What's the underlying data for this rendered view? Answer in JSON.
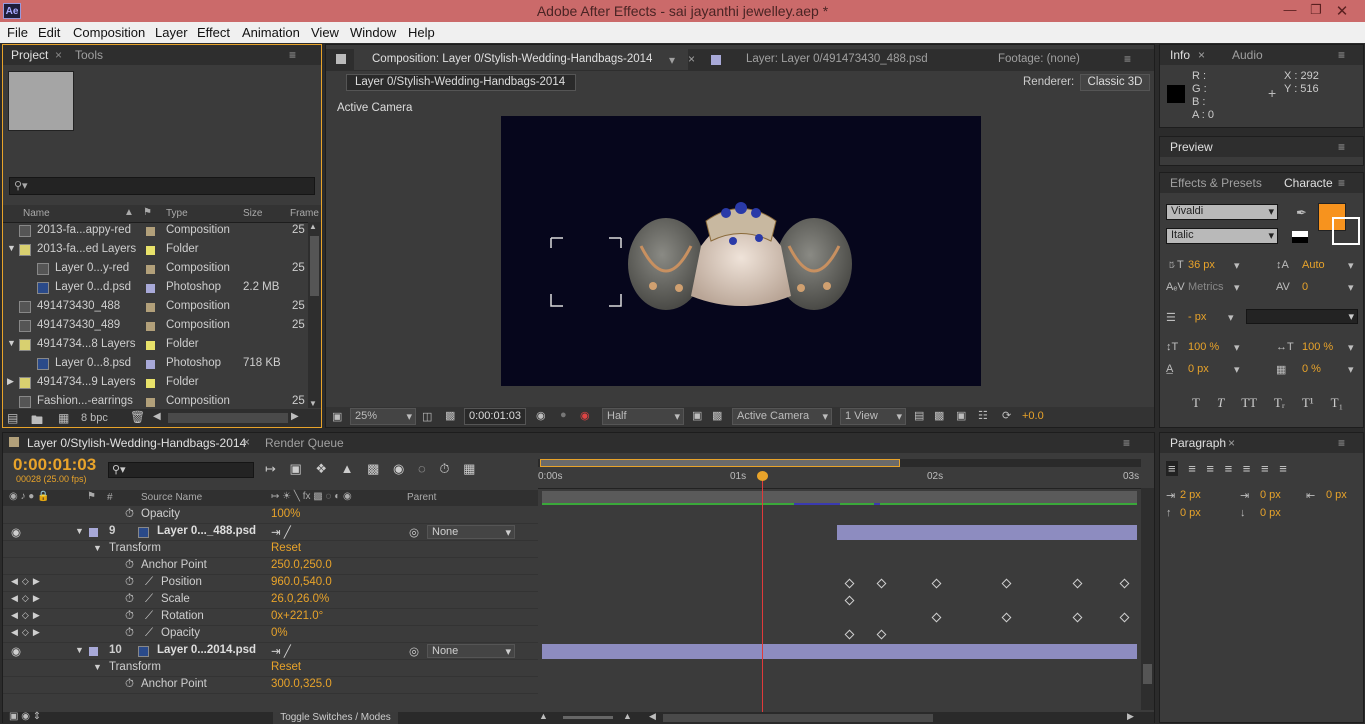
{
  "app": {
    "title": "Adobe After Effects - sai jayanthi jewelley.aep *",
    "logo": "Ae"
  },
  "menu": [
    "File",
    "Edit",
    "Composition",
    "Layer",
    "Effect",
    "Animation",
    "View",
    "Window",
    "Help"
  ],
  "project": {
    "tabs": [
      "Project",
      "Tools"
    ],
    "columns": [
      "Name",
      "Type",
      "Size",
      "Frame"
    ],
    "items": [
      {
        "name": "2013-fa...appy-red",
        "type": "Composition",
        "size": "",
        "frame": "25",
        "color": "#b2a07a",
        "icon": "composition-icon"
      },
      {
        "name": "2013-fa...ed Layers",
        "type": "Folder",
        "size": "",
        "frame": "",
        "color": "#e8e26a",
        "icon": "folder-icon"
      },
      {
        "name": "Layer 0...y-red",
        "type": "Composition",
        "size": "",
        "frame": "25",
        "color": "#b2a07a",
        "icon": "composition-icon"
      },
      {
        "name": "Layer 0...d.psd",
        "type": "Photoshop",
        "size": "2.2 MB",
        "frame": "",
        "color": "#a8a9d8",
        "icon": "photoshop-icon"
      },
      {
        "name": "491473430_488",
        "type": "Composition",
        "size": "",
        "frame": "25",
        "color": "#b2a07a",
        "icon": "composition-icon"
      },
      {
        "name": "491473430_489",
        "type": "Composition",
        "size": "",
        "frame": "25",
        "color": "#b2a07a",
        "icon": "composition-icon"
      },
      {
        "name": "4914734...8 Layers",
        "type": "Folder",
        "size": "",
        "frame": "",
        "color": "#e8e26a",
        "icon": "folder-icon"
      },
      {
        "name": "Layer 0...8.psd",
        "type": "Photoshop",
        "size": "718 KB",
        "frame": "",
        "color": "#a8a9d8",
        "icon": "photoshop-icon"
      },
      {
        "name": "4914734...9 Layers",
        "type": "Folder",
        "size": "",
        "frame": "",
        "color": "#e8e26a",
        "icon": "folder-icon"
      },
      {
        "name": "Fashion...-earrings",
        "type": "Composition",
        "size": "",
        "frame": "25",
        "color": "#b2a07a",
        "icon": "composition-icon"
      }
    ],
    "bpc": "8 bpc"
  },
  "composition": {
    "tab": "Composition: Layer 0/Stylish-Wedding-Handbags-2014",
    "layer_tab": "Layer: Layer 0/491473430_488.psd",
    "footage_tab": "Footage: (none)",
    "breadcrumb": "Layer 0/Stylish-Wedding-Handbags-2014",
    "renderer_label": "Renderer:",
    "renderer": "Classic 3D",
    "camera_label": "Active Camera",
    "zoom": "25%",
    "time": "0:00:01:03",
    "resolution": "Half",
    "view": "Active Camera",
    "views": "1 View",
    "exposure": "+0.0"
  },
  "info": {
    "tabs": [
      "Info",
      "Audio"
    ],
    "r": "R :",
    "g": "G :",
    "b": "B :",
    "a": "A : 0",
    "x": "X : 292",
    "y": "Y : 516"
  },
  "preview": {
    "tab": "Preview"
  },
  "character": {
    "tabs": [
      "Effects & Presets",
      "Characte"
    ],
    "font": "Vivaldi",
    "style": "Italic",
    "size": "36 px",
    "leading": "Auto",
    "kerning": "Metrics",
    "tracking": "0",
    "stroke": "- px",
    "vscale": "100 %",
    "hscale": "100 %",
    "baseline": "0 px",
    "tsume": "0 %",
    "fill_color": "#f7931e"
  },
  "paragraph": {
    "tab": "Paragraph",
    "indent_left": "2 px",
    "indent_first": "0 px",
    "indent_right": "0 px",
    "space_before": "0 px",
    "space_after": "0 px"
  },
  "timeline": {
    "tabs": [
      "Layer 0/Stylish-Wedding-Handbags-2014",
      "Render Queue"
    ],
    "time": "0:00:01:03",
    "frames": "00028 (25.00 fps)",
    "col_source": "Source Name",
    "col_parent": "Parent",
    "ruler": [
      "0:00s",
      "01s",
      "02s",
      "03s"
    ],
    "toggle": "Toggle Switches / Modes",
    "rows": [
      {
        "kind": "prop",
        "label": "Opacity",
        "value": "100%"
      },
      {
        "kind": "layer",
        "num": "9",
        "name": "Layer 0..._488.psd",
        "parent": "None"
      },
      {
        "kind": "group",
        "label": "Transform",
        "value": "Reset"
      },
      {
        "kind": "prop",
        "label": "Anchor Point",
        "value": "250.0,250.0"
      },
      {
        "kind": "prop",
        "label": "Position",
        "value": "960.0,540.0",
        "kf": true
      },
      {
        "kind": "prop",
        "label": "Scale",
        "value": "26.0,26.0%",
        "kf": true
      },
      {
        "kind": "prop",
        "label": "Rotation",
        "value": "0x+221.0°",
        "kf": true
      },
      {
        "kind": "prop",
        "label": "Opacity",
        "value": "0%",
        "kf": true
      },
      {
        "kind": "layer",
        "num": "10",
        "name": "Layer 0...2014.psd",
        "parent": "None"
      },
      {
        "kind": "group",
        "label": "Transform",
        "value": "Reset"
      },
      {
        "kind": "prop",
        "label": "Anchor Point",
        "value": "300.0,325.0"
      }
    ],
    "keyframes": {
      "rows": [
        4,
        5,
        6,
        7
      ],
      "times": [
        [
          1.57,
          1.73,
          2.01,
          2.37,
          2.73,
          2.97
        ],
        [
          1.57
        ],
        [
          2.01,
          2.37,
          2.73,
          2.97
        ],
        [
          1.57,
          1.73
        ]
      ]
    },
    "current_time_s": 1.12
  },
  "colors": {
    "accent": "#e8a32a",
    "title_bar": "#cb6a6a",
    "layer_bar": "#8d8cc0",
    "playhead": "#e03a3a"
  }
}
